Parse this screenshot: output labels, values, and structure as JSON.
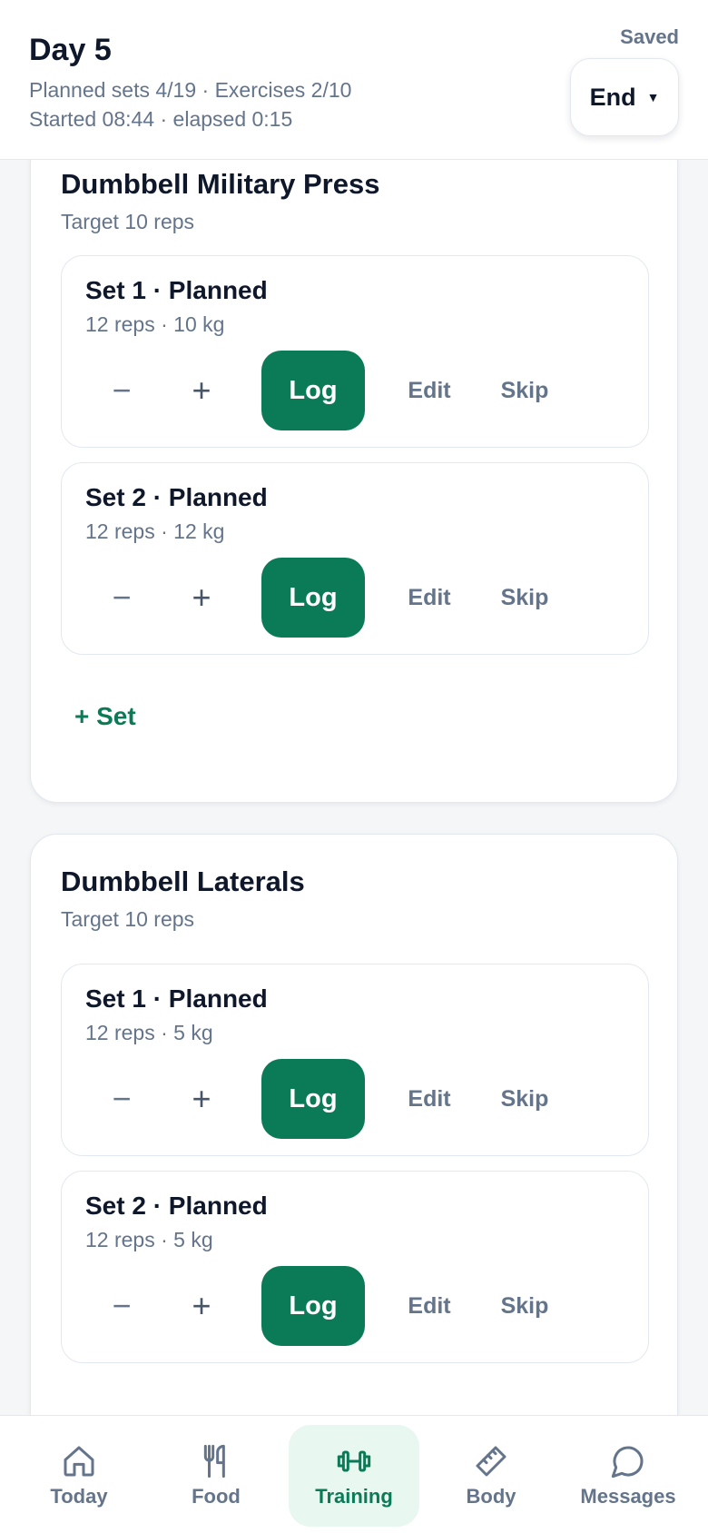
{
  "header": {
    "title": "Day 5",
    "planned_line": "Planned sets 4/19 · Exercises 2/10",
    "started_line": "Started 08:44 · elapsed 0:15",
    "saved_label": "Saved",
    "end_label": "End"
  },
  "controls": {
    "minus": "−",
    "plus": "+",
    "log": "Log",
    "edit": "Edit",
    "skip": "Skip",
    "add_set": "+ Set"
  },
  "exercises": [
    {
      "name": "Dumbbell Military Press",
      "target": "Target 10 reps",
      "sets": [
        {
          "title": "Set 1 · Planned",
          "detail": "12 reps · 10 kg"
        },
        {
          "title": "Set 2 · Planned",
          "detail": "12 reps · 12 kg"
        }
      ]
    },
    {
      "name": "Dumbbell Laterals",
      "target": "Target 10 reps",
      "sets": [
        {
          "title": "Set 1 · Planned",
          "detail": "12 reps · 5 kg"
        },
        {
          "title": "Set 2 · Planned",
          "detail": "12 reps · 5 kg"
        }
      ]
    }
  ],
  "nav": {
    "items": [
      {
        "label": "Today",
        "icon": "home-icon"
      },
      {
        "label": "Food",
        "icon": "fork-knife-icon"
      },
      {
        "label": "Training",
        "icon": "dumbbell-icon",
        "active": true
      },
      {
        "label": "Body",
        "icon": "ruler-icon"
      },
      {
        "label": "Messages",
        "icon": "chat-bubble-icon"
      }
    ]
  },
  "colors": {
    "accent": "#0b7a57",
    "active_nav_bg": "#e8f7ef",
    "muted_text": "#64748b",
    "background": "#f5f6f8"
  }
}
